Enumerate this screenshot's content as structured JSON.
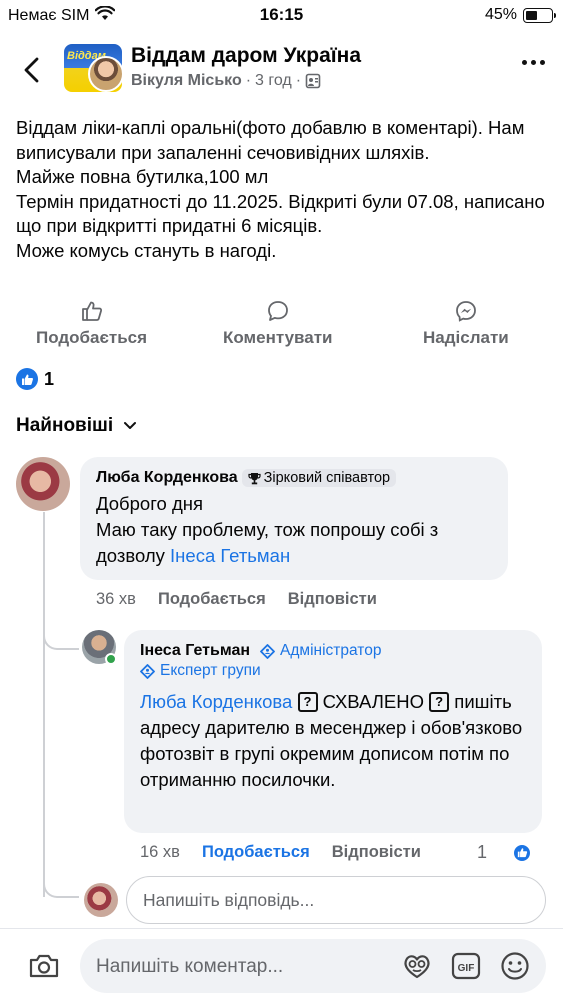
{
  "status_bar": {
    "carrier": "Немає SIM",
    "time": "16:15",
    "battery_pct": "45%",
    "battery_level": 0.45
  },
  "header": {
    "group_name": "Віддам даром Україна",
    "author": "Вікуля Місько",
    "time_ago": "3 год",
    "separator": "·",
    "avatar_text": "Віддам"
  },
  "post": {
    "text": "Віддам ліки-каплі оральні(фото добавлю в коментарі). Нам виписували при запаленні сечовивідних шляхів.\nМайже повна бутилка,100 мл\nТермін придатності до 11.2025. Відкриті були 07.08, написано що при відкритті придатні 6 місяців.\nМоже комусь стануть в нагоді."
  },
  "actions": {
    "like": "Подобається",
    "comment": "Коментувати",
    "share": "Надіслати"
  },
  "reactions": {
    "count": "1"
  },
  "sort": {
    "label": "Найновіші"
  },
  "comments": [
    {
      "name": "Люба Корденкова",
      "badge": "Зірковий співавтор",
      "line1": "Доброго дня",
      "line2_prefix": "Маю таку проблему, тож попрошу собі з дозволу ",
      "mention": "Інеса Гетьман",
      "time": "36 хв",
      "like": "Подобається",
      "reply": "Відповісти"
    }
  ],
  "reply": {
    "name": "Інеса Гетьман",
    "role1": "Адміністратор",
    "role2": "Експерт групи",
    "mention": "Люба Корденкова",
    "q1": "?",
    "approved": "СХВАЛЕНО",
    "q2": "?",
    "text_rest": "пишіть адресу дарителю в месенджер і обов'язково фотозвіт в групі окремим дописом потім по отриманню посилочки.",
    "time": "16 хв",
    "like": "Подобається",
    "reply": "Відповісти",
    "like_count": "1"
  },
  "reply_input": {
    "placeholder": "Напишіть відповідь..."
  },
  "comment_input": {
    "placeholder": "Напишіть коментар..."
  },
  "colors": {
    "accent": "#1b74e4",
    "bubble": "#f0f2f5",
    "meta": "#65676b"
  }
}
